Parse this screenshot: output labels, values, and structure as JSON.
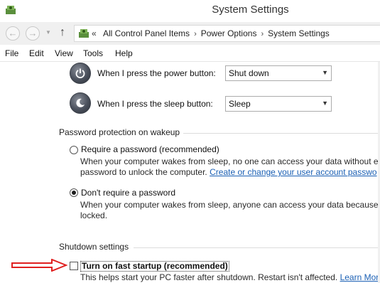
{
  "window": {
    "title": "System Settings"
  },
  "nav": {
    "back_glyph": "←",
    "forward_glyph": "→",
    "dropdown_glyph": "▼",
    "up_glyph": "↑",
    "breadcrumb_chevron": "«",
    "separator_glyph": "›",
    "breadcrumbs": [
      "All Control Panel Items",
      "Power Options",
      "System Settings"
    ]
  },
  "menu": {
    "file": "File",
    "edit": "Edit",
    "view": "View",
    "tools": "Tools",
    "help": "Help"
  },
  "buttons": {
    "power": {
      "label": "When I press the power button:",
      "value": "Shut down"
    },
    "sleep": {
      "label": "When I press the sleep button:",
      "value": "Sleep"
    },
    "dropdown_arrow": "▼"
  },
  "password": {
    "section_title": "Password protection on wakeup",
    "require": {
      "label": "Require a password (recommended)",
      "desc_line1": "When your computer wakes from sleep, no one can access your data without en",
      "desc_line2_prefix": "password to unlock the computer.",
      "link": "Create or change your user account passwo"
    },
    "dont_require": {
      "label": "Don't require a password",
      "desc_line1": "When your computer wakes from sleep, anyone can access your data because th",
      "desc_line2": "locked."
    },
    "selected": "dont_require"
  },
  "shutdown": {
    "section_title": "Shutdown settings",
    "fast_startup": {
      "label": "Turn on fast startup (recommended)",
      "checked": false,
      "desc": "This helps start your PC faster after shutdown. Restart isn't affected.",
      "link": "Learn More"
    }
  },
  "colors": {
    "annotation_arrow": "#e02020",
    "link": "#1a5fb4"
  }
}
